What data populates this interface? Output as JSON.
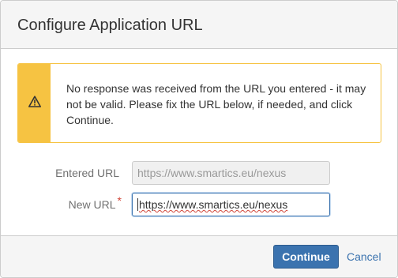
{
  "dialog": {
    "title": "Configure Application URL"
  },
  "warning": {
    "icon": "warning-triangle-icon",
    "message": "No response was received from the URL you entered - it may not be valid. Please fix the URL below, if needed, and click Continue."
  },
  "form": {
    "entered_url": {
      "label": "Entered URL",
      "value": "https://www.smartics.eu/nexus"
    },
    "new_url": {
      "label": "New URL",
      "required_marker": "*",
      "value": "https://www.smartics.eu/nexus"
    }
  },
  "footer": {
    "continue_label": "Continue",
    "cancel_label": "Cancel"
  },
  "colors": {
    "warning": "#f6c342",
    "primary": "#3b73af",
    "required": "#d04437"
  }
}
